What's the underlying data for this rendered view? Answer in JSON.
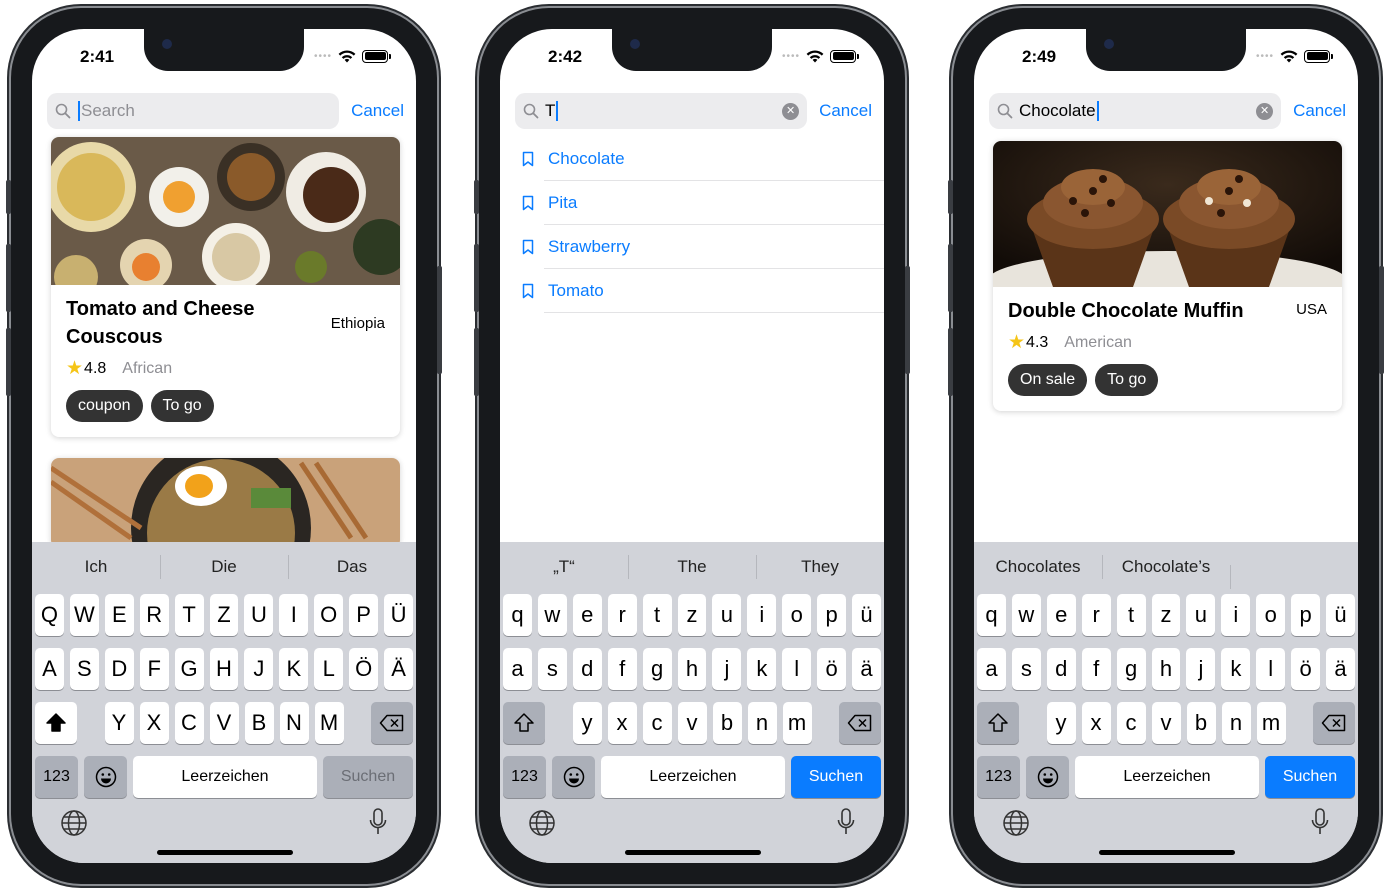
{
  "phones": [
    {
      "time": "2:41",
      "search": {
        "value": "",
        "placeholder": "Search",
        "cancel": "Cancel"
      },
      "card": {
        "title": "Tomato and Cheese Couscous",
        "country": "Ethiopia",
        "rating": "4.8",
        "cuisine": "African",
        "tags": [
          "coupon",
          "To go"
        ]
      },
      "predictions": [
        "Ich",
        "Die",
        "Das"
      ],
      "rows": [
        [
          "Q",
          "W",
          "E",
          "R",
          "T",
          "Z",
          "U",
          "I",
          "O",
          "P",
          "Ü"
        ],
        [
          "A",
          "S",
          "D",
          "F",
          "G",
          "H",
          "J",
          "K",
          "L",
          "Ö",
          "Ä"
        ],
        [
          "Y",
          "X",
          "C",
          "V",
          "B",
          "N",
          "M"
        ]
      ],
      "space": "Leerzeichen",
      "search_key": "Suchen",
      "num_key": "123"
    },
    {
      "time": "2:42",
      "search": {
        "value": "T",
        "placeholder": "",
        "cancel": "Cancel"
      },
      "suggestions": [
        "Chocolate",
        "Pita",
        "Strawberry",
        "Tomato"
      ],
      "predictions": [
        "„T“",
        "The",
        "They"
      ],
      "rows": [
        [
          "q",
          "w",
          "e",
          "r",
          "t",
          "z",
          "u",
          "i",
          "o",
          "p",
          "ü"
        ],
        [
          "a",
          "s",
          "d",
          "f",
          "g",
          "h",
          "j",
          "k",
          "l",
          "ö",
          "ä"
        ],
        [
          "y",
          "x",
          "c",
          "v",
          "b",
          "n",
          "m"
        ]
      ],
      "space": "Leerzeichen",
      "search_key": "Suchen",
      "num_key": "123"
    },
    {
      "time": "2:49",
      "search": {
        "value": "Chocolate",
        "placeholder": "",
        "cancel": "Cancel"
      },
      "card": {
        "title": "Double Chocolate Muffin",
        "country": "USA",
        "rating": "4.3",
        "cuisine": "American",
        "tags": [
          "On sale",
          "To go"
        ]
      },
      "predictions": [
        "Chocolates",
        "Chocolate’s",
        ""
      ],
      "rows": [
        [
          "q",
          "w",
          "e",
          "r",
          "t",
          "z",
          "u",
          "i",
          "o",
          "p",
          "ü"
        ],
        [
          "a",
          "s",
          "d",
          "f",
          "g",
          "h",
          "j",
          "k",
          "l",
          "ö",
          "ä"
        ],
        [
          "y",
          "x",
          "c",
          "v",
          "b",
          "n",
          "m"
        ]
      ],
      "space": "Leerzeichen",
      "search_key": "Suchen",
      "num_key": "123"
    }
  ],
  "colors": {
    "accent": "#0a7cff",
    "tag": "#333333",
    "star": "#f5c518"
  }
}
